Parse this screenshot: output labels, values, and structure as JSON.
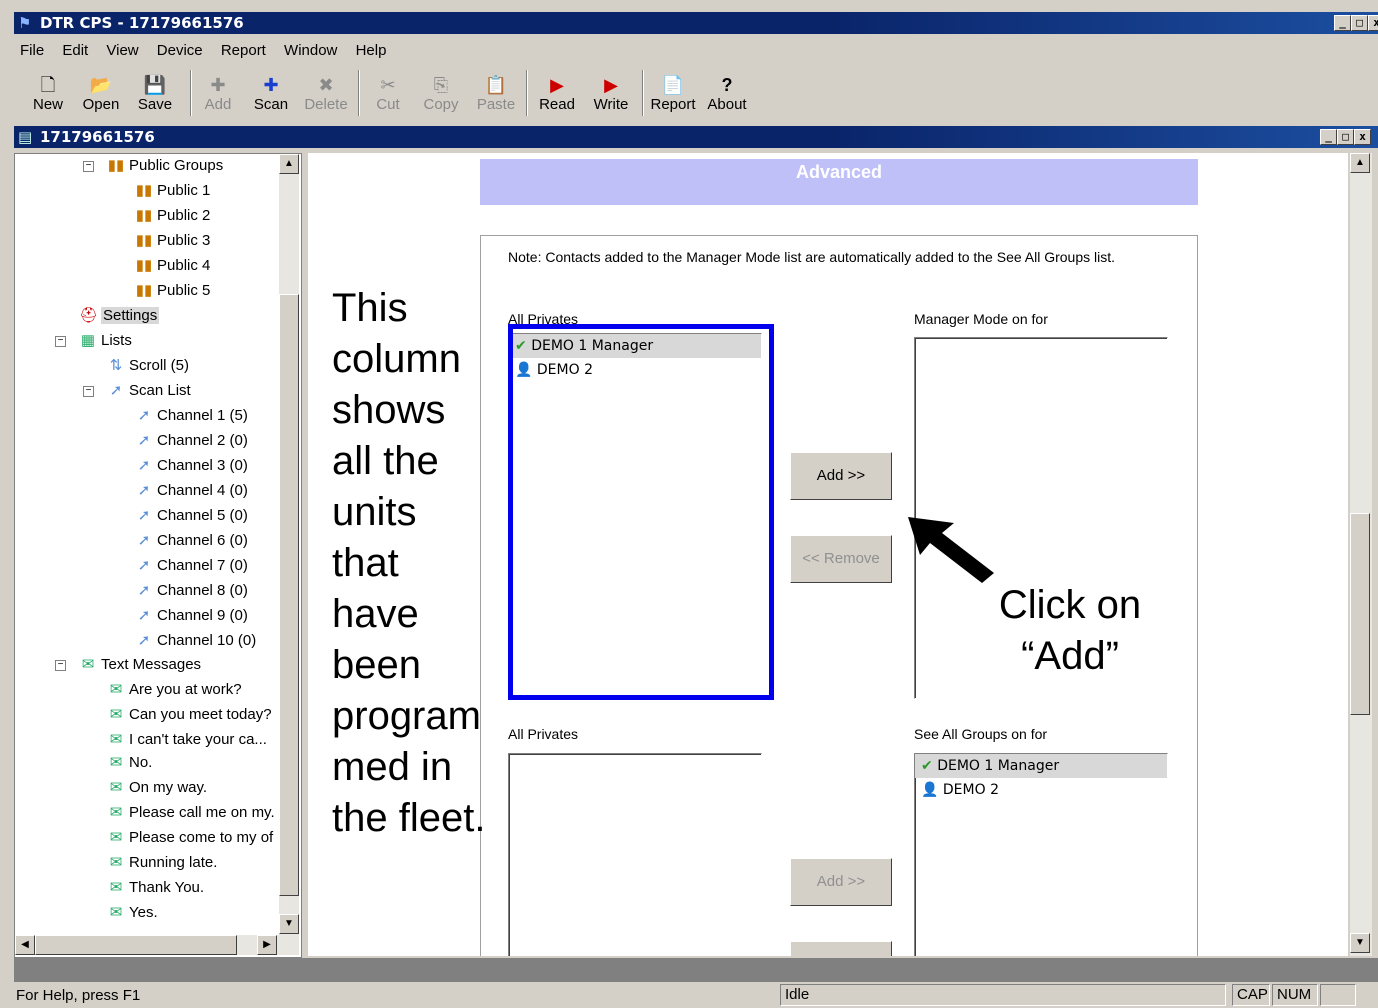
{
  "window": {
    "title": "DTR CPS - 17179661576",
    "child_title": "17179661576"
  },
  "menu": [
    "File",
    "Edit",
    "View",
    "Device",
    "Report",
    "Window",
    "Help"
  ],
  "toolbar": [
    {
      "label": "New",
      "icon": "new-icon",
      "glyph": "🗋",
      "enabled": true
    },
    {
      "label": "Open",
      "icon": "open-folder-icon",
      "glyph": "📂",
      "enabled": true
    },
    {
      "label": "Save",
      "icon": "save-icon",
      "glyph": "💾",
      "enabled": true
    },
    {
      "label": "Add",
      "icon": "add-icon",
      "glyph": "✚",
      "enabled": false
    },
    {
      "label": "Scan",
      "icon": "scan-icon",
      "glyph": "✚",
      "enabled": true
    },
    {
      "label": "Delete",
      "icon": "delete-icon",
      "glyph": "✖",
      "enabled": false
    },
    {
      "label": "Cut",
      "icon": "cut-icon",
      "glyph": "✂",
      "enabled": false
    },
    {
      "label": "Copy",
      "icon": "copy-icon",
      "glyph": "⎘",
      "enabled": false
    },
    {
      "label": "Paste",
      "icon": "paste-icon",
      "glyph": "📋",
      "enabled": false
    },
    {
      "label": "Read",
      "icon": "read-icon",
      "glyph": "▶",
      "enabled": true
    },
    {
      "label": "Write",
      "icon": "write-icon",
      "glyph": "▶",
      "enabled": true
    },
    {
      "label": "Report",
      "icon": "report-icon",
      "glyph": "📄",
      "enabled": true
    },
    {
      "label": "About",
      "icon": "about-icon",
      "glyph": "?",
      "enabled": true
    }
  ],
  "tree": {
    "public_groups": "Public Groups",
    "publics": [
      "Public 1",
      "Public 2",
      "Public 3",
      "Public 4",
      "Public 5"
    ],
    "settings": "Settings",
    "lists": "Lists",
    "scroll": "Scroll (5)",
    "scan_list": "Scan List",
    "channels": [
      "Channel 1 (5)",
      "Channel 2 (0)",
      "Channel 3 (0)",
      "Channel 4 (0)",
      "Channel 5 (0)",
      "Channel 6 (0)",
      "Channel 7 (0)",
      "Channel 8 (0)",
      "Channel 9 (0)",
      "Channel 10 (0)"
    ],
    "text_messages": "Text Messages",
    "messages": [
      "Are you at work?",
      "Can you meet today?",
      "I can't take your ca...",
      "No.",
      "On my way.",
      "Please call me on my.",
      "Please come to my of",
      "Running late.",
      "Thank You.",
      "Yes."
    ]
  },
  "content": {
    "header": "Advanced",
    "note": "Note: Contacts added to the Manager Mode list are automatically added to the See All Groups list.",
    "privates1_label": "All Privates",
    "manager_label": "Manager Mode on for",
    "privates2_label": "All Privates",
    "see_all_label": "See All Groups on for",
    "privates1": [
      "DEMO 1 Manager",
      "DEMO 2"
    ],
    "see_all": [
      "DEMO 1 Manager",
      "DEMO 2"
    ],
    "add": "Add >>",
    "remove": "<< Remove",
    "add2": "Add >>"
  },
  "annotation": {
    "column_lines": [
      "This",
      "column",
      "shows",
      "all the",
      "units",
      "that",
      "have",
      "been",
      "program",
      "med in",
      "the fleet."
    ],
    "click": [
      "Click on",
      "“Add”"
    ]
  },
  "status": {
    "help": "For Help, press F1",
    "state": "Idle",
    "cap": "CAP",
    "num": "NUM"
  },
  "colors": {
    "title_bar": "#0a246a",
    "header_band": "#c0c0f8",
    "highlight_box": "#0000ee"
  }
}
